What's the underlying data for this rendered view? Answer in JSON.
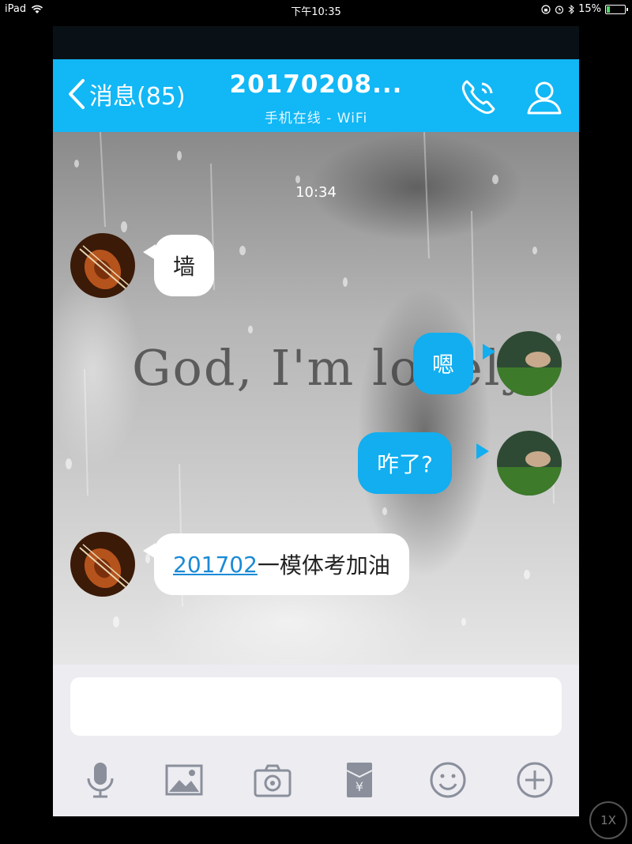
{
  "status_bar": {
    "device": "iPad",
    "time": "下午10:35",
    "battery": "15%",
    "battery_level": 0.15,
    "icons": [
      "wifi-icon",
      "lock-rotation-icon",
      "alarm-icon",
      "bluetooth-icon",
      "battery-icon"
    ]
  },
  "nav": {
    "back_label": "消息(85)",
    "title": "20170208...",
    "subtitle": "手机在线 - WiFi",
    "icons": [
      "chevron-left-icon",
      "phone-icon",
      "profile-icon"
    ],
    "accent": "#12b7f5"
  },
  "chat": {
    "background_text": "God, I'm lonely",
    "timestamp": "10:34",
    "messages": [
      {
        "side": "in",
        "text": "墙"
      },
      {
        "side": "out",
        "text": "嗯"
      },
      {
        "side": "out",
        "text": "咋了?"
      },
      {
        "side": "in",
        "link_text": "201702",
        "text": "一模体考加油"
      }
    ],
    "outgoing_bubble_color": "#12aef0",
    "incoming_bubble_color": "#ffffff"
  },
  "input": {
    "text": "",
    "toolbar_icons": [
      "microphone-icon",
      "image-icon",
      "camera-icon",
      "red-packet-icon",
      "emoji-icon",
      "plus-icon"
    ]
  },
  "zoom_label": "1X"
}
